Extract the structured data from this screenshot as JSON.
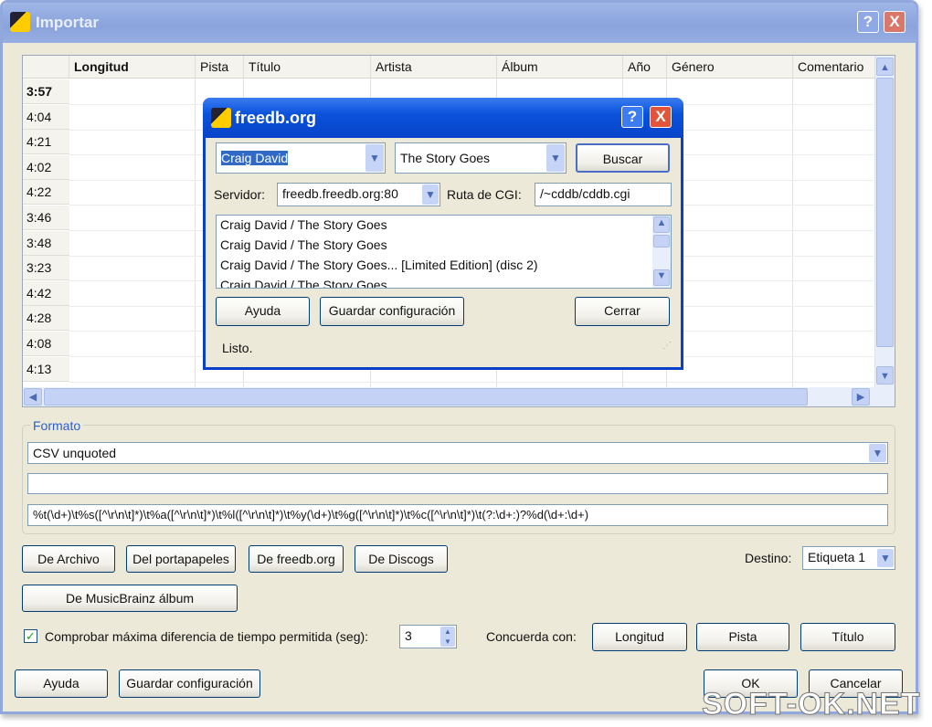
{
  "main_window": {
    "title": "Importar",
    "help": "?",
    "close": "X"
  },
  "grid": {
    "columns": [
      "Longitud",
      "Pista",
      "Título",
      "Artista",
      "Álbum",
      "Año",
      "Género",
      "Comentario"
    ],
    "rows": [
      "3:57",
      "4:04",
      "4:21",
      "4:02",
      "4:22",
      "3:46",
      "3:48",
      "3:23",
      "4:42",
      "4:28",
      "4:08",
      "4:13"
    ]
  },
  "format": {
    "legend": "Formato",
    "selected": "CSV unquoted",
    "text1": "",
    "pattern": "%t(\\d+)\\t%s([^\\r\\n\\t]*)\\t%a([^\\r\\n\\t]*)\\t%l([^\\r\\n\\t]*)\\t%y(\\d+)\\t%g([^\\r\\n\\t]*)\\t%c([^\\r\\n\\t]*)\\t(?:\\d+:)?%d(\\d+:\\d+)"
  },
  "sources": {
    "file": "De Archivo",
    "clipboard": "Del portapapeles",
    "freedb": "De freedb.org",
    "discogs": "De Discogs",
    "musicbrainz": "De MusicBrainz álbum"
  },
  "destination": {
    "label": "Destino:",
    "value": "Etiqueta 1"
  },
  "check": {
    "label": "Comprobar máxima diferencia de tiempo permitida (seg):",
    "checked": true,
    "value": "3"
  },
  "match": {
    "label": "Concuerda con:",
    "length": "Longitud",
    "track": "Pista",
    "title": "Título"
  },
  "footer": {
    "help": "Ayuda",
    "save": "Guardar configuración",
    "ok": "OK",
    "cancel": "Cancelar"
  },
  "freedb": {
    "title": "freedb.org",
    "help": "?",
    "close": "X",
    "artist": "Craig David",
    "album": "The Story Goes",
    "search": "Buscar",
    "server_label": "Servidor:",
    "server": "freedb.freedb.org:80",
    "cgi_label": "Ruta de CGI:",
    "cgi": "/~cddb/cddb.cgi",
    "results": [
      "Craig David / The Story Goes",
      "Craig David / The Story Goes",
      "Craig David / The Story Goes... [Limited Edition] (disc 2)",
      "Craig David / The Story Goes"
    ],
    "help_btn": "Ayuda",
    "save": "Guardar configuración",
    "close_btn": "Cerrar",
    "status": "Listo."
  },
  "watermark": "SOFT-OK.NET"
}
